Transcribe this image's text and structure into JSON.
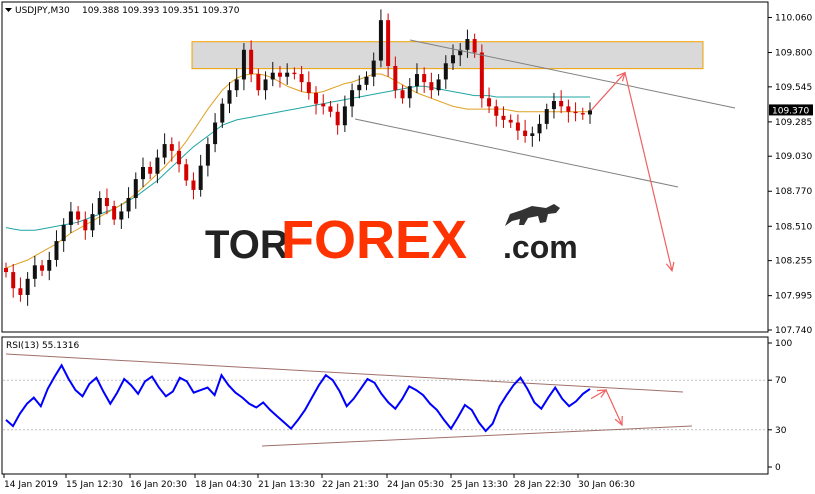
{
  "header": {
    "symbol": "USDJPY,M30",
    "ohlc": "109.388 109.393 109.351 109.370"
  },
  "watermark": {
    "part1": "TOR",
    "part2": "FOREX",
    "part3": ".com"
  },
  "price_axis": {
    "ticks": [
      "110.060",
      "109.800",
      "109.545",
      "109.285",
      "109.030",
      "108.770",
      "108.510",
      "108.255",
      "107.995",
      "107.740"
    ],
    "current_label": "109.370"
  },
  "rsi": {
    "label": "RSI(13) 55.1316",
    "ticks": [
      "100",
      "70",
      "30",
      "0"
    ]
  },
  "time_axis": {
    "labels": [
      "14 Jan 2019",
      "15 Jan 12:30",
      "16 Jan 20:30",
      "18 Jan 04:30",
      "21 Jan 13:30",
      "22 Jan 21:30",
      "24 Jan 05:30",
      "25 Jan 13:30",
      "28 Jan 22:30",
      "30 Jan 06:30"
    ]
  },
  "colors": {
    "candle_up": "#111111",
    "candle_down": "#d40000",
    "ma_fast": "#e0a020",
    "ma_slow": "#21a5a5",
    "channel": "#808080",
    "zone_fill": "#d9d9d9",
    "zone_border": "#f0a000",
    "forecast_arrow": "#f06060",
    "rsi_line": "#0000ff",
    "rsi_channel": "#a0706a",
    "brand_red": "#ff3300"
  },
  "chart_data": {
    "type": "candlestick",
    "symbol": "USDJPY",
    "timeframe": "M30",
    "ylim": [
      107.74,
      110.16
    ],
    "close": [
      108.17,
      108.05,
      108.0,
      108.12,
      108.22,
      108.18,
      108.26,
      108.4,
      108.52,
      108.62,
      108.56,
      108.48,
      108.6,
      108.72,
      108.66,
      108.56,
      108.62,
      108.72,
      108.86,
      108.95,
      108.9,
      109.02,
      109.12,
      109.07,
      108.97,
      108.85,
      108.78,
      108.96,
      109.12,
      109.28,
      109.42,
      109.52,
      109.6,
      109.82,
      109.64,
      109.52,
      109.6,
      109.65,
      109.62,
      109.65,
      109.64,
      109.58,
      109.5,
      109.42,
      109.4,
      109.36,
      109.26,
      109.4,
      109.52,
      109.56,
      109.62,
      109.74,
      110.04,
      109.7,
      109.52,
      109.46,
      109.55,
      109.64,
      109.58,
      109.52,
      109.6,
      109.72,
      109.78,
      109.82,
      109.9,
      109.8,
      109.46,
      109.4,
      109.33,
      109.3,
      109.28,
      109.22,
      109.18,
      109.2,
      109.27,
      109.38,
      109.44,
      109.4,
      109.36,
      109.35,
      109.34,
      109.37
    ],
    "ma_fast": [
      108.2,
      108.22,
      108.24,
      108.26,
      108.29,
      108.32,
      108.35,
      108.38,
      108.42,
      108.46,
      108.49,
      108.52,
      108.55,
      108.58,
      108.61,
      108.64,
      108.67,
      108.71,
      108.75,
      108.8,
      108.85,
      108.9,
      108.95,
      109.01,
      109.07,
      109.14,
      109.22,
      109.3,
      109.38,
      109.45,
      109.52,
      109.57,
      109.61,
      109.63,
      109.64,
      109.64,
      109.63,
      109.61,
      109.58,
      109.55,
      109.53,
      109.51,
      109.5,
      109.5,
      109.51,
      109.53,
      109.55,
      109.57,
      109.58,
      109.6,
      109.62,
      109.64,
      109.64,
      109.62,
      109.59,
      109.56,
      109.53,
      109.5,
      109.48,
      109.46,
      109.44,
      109.42,
      109.4,
      109.39,
      109.38,
      109.38,
      109.38,
      109.38,
      109.38,
      109.38,
      109.37,
      109.36,
      109.36,
      109.36,
      109.36,
      109.36,
      109.36,
      109.36,
      109.36,
      109.36,
      109.36,
      109.36
    ],
    "ma_slow": [
      108.5,
      108.49,
      108.48,
      108.48,
      108.48,
      108.49,
      108.5,
      108.51,
      108.52,
      108.53,
      108.54,
      108.56,
      108.58,
      108.6,
      108.62,
      108.64,
      108.67,
      108.7,
      108.73,
      108.77,
      108.81,
      108.85,
      108.9,
      108.95,
      109.0,
      109.05,
      109.1,
      109.14,
      109.18,
      109.22,
      109.26,
      109.28,
      109.3,
      109.31,
      109.32,
      109.33,
      109.34,
      109.35,
      109.36,
      109.37,
      109.38,
      109.39,
      109.4,
      109.41,
      109.42,
      109.43,
      109.44,
      109.45,
      109.46,
      109.47,
      109.48,
      109.49,
      109.5,
      109.51,
      109.52,
      109.53,
      109.54,
      109.55,
      109.55,
      109.54,
      109.53,
      109.52,
      109.51,
      109.5,
      109.49,
      109.48,
      109.48,
      109.48,
      109.47,
      109.47,
      109.47,
      109.47,
      109.47,
      109.47,
      109.47,
      109.47,
      109.47,
      109.47,
      109.47,
      109.47,
      109.47,
      109.47
    ],
    "resistance_zone": [
      109.68,
      109.88
    ],
    "channel_upper": [
      [
        109.96,
        109.72
      ],
      [
        109.4,
        109.5
      ]
    ],
    "channel_lower": [
      [
        109.4,
        109.16
      ],
      [
        109.08,
        108.9
      ]
    ],
    "forecast": [
      109.37,
      109.65,
      108.18
    ],
    "rsi_period": 13,
    "rsi_value": 55.1316,
    "rsi_ylim": [
      0,
      100
    ],
    "rsi_levels": [
      70,
      30
    ],
    "rsi": [
      38,
      33,
      43,
      51,
      56,
      49,
      63,
      73,
      82,
      71,
      62,
      57,
      67,
      72,
      61,
      51,
      60,
      71,
      66,
      59,
      69,
      73,
      64,
      57,
      61,
      72,
      69,
      60,
      62,
      64,
      58,
      74,
      66,
      60,
      56,
      51,
      48,
      52,
      46,
      41,
      36,
      31,
      38,
      46,
      56,
      66,
      74,
      70,
      61,
      49,
      55,
      63,
      71,
      68,
      59,
      52,
      47,
      55,
      65,
      62,
      58,
      51,
      46,
      38,
      31,
      40,
      50,
      46,
      36,
      29,
      35,
      49,
      58,
      66,
      72,
      63,
      52,
      47,
      56,
      64,
      55,
      49,
      53,
      59,
      63
    ]
  }
}
